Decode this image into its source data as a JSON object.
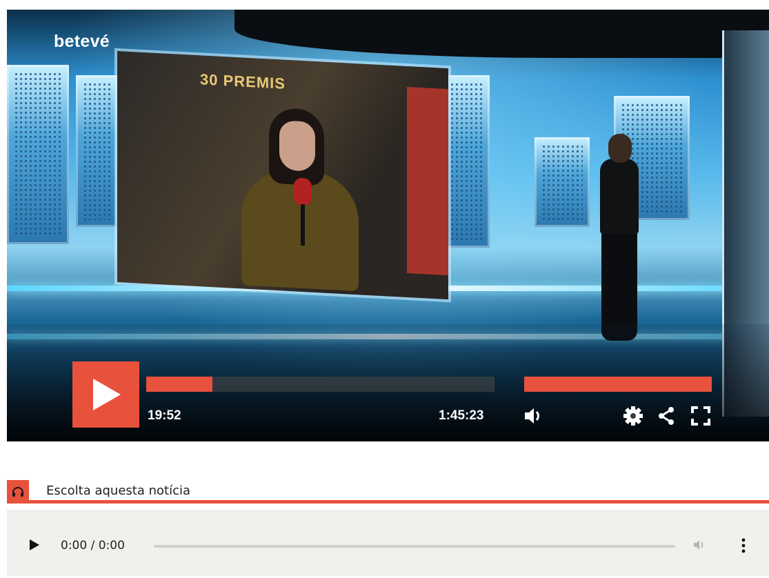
{
  "player": {
    "logo": "betevé",
    "backdrop_text": "30 PREMIS",
    "current_time": "19:52",
    "total_time": "1:45:23",
    "progress_fraction": 0.19,
    "accent_color": "#e8513b",
    "icons": [
      "play-icon",
      "volume-icon",
      "settings-icon",
      "share-icon",
      "fullscreen-icon"
    ]
  },
  "listen": {
    "label": "Escolta aquesta notícia",
    "icon": "headphones-icon"
  },
  "audio": {
    "time": "0:00 / 0:00",
    "icons": [
      "play-icon",
      "volume-icon",
      "more-options-icon"
    ]
  }
}
